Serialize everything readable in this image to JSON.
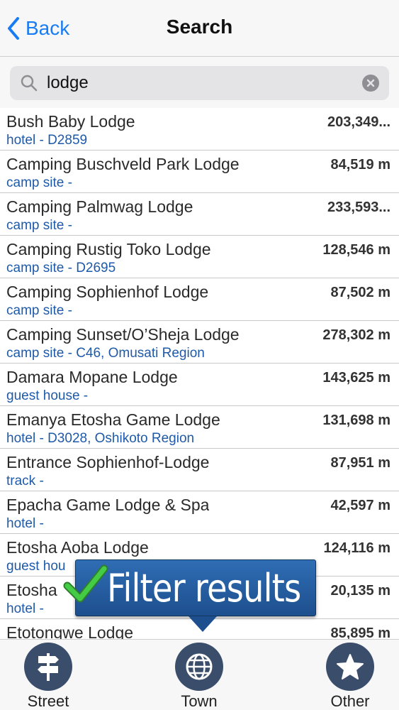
{
  "nav": {
    "back_label": "Back",
    "title": "Search"
  },
  "search": {
    "value": "lodge"
  },
  "results": [
    {
      "name": "Bush Baby Lodge",
      "sub": "hotel - D2859",
      "dist": "203,349..."
    },
    {
      "name": "Camping Buschveld Park Lodge",
      "sub": "camp site -",
      "dist": "84,519 m"
    },
    {
      "name": "Camping Palmwag Lodge",
      "sub": "camp site -",
      "dist": "233,593..."
    },
    {
      "name": "Camping Rustig Toko Lodge",
      "sub": "camp site - D2695",
      "dist": "128,546 m"
    },
    {
      "name": "Camping Sophienhof Lodge",
      "sub": "camp site -",
      "dist": "87,502 m"
    },
    {
      "name": "Camping Sunset/O’Sheja Lodge",
      "sub": "camp site - C46, Omusati Region",
      "dist": "278,302 m"
    },
    {
      "name": "Damara Mopane Lodge",
      "sub": "guest house -",
      "dist": "143,625 m"
    },
    {
      "name": "Emanya Etosha Game Lodge",
      "sub": "hotel - D3028, Oshikoto Region",
      "dist": "131,698 m"
    },
    {
      "name": "Entrance Sophienhof-Lodge",
      "sub": "track -",
      "dist": "87,951 m"
    },
    {
      "name": "Epacha Game Lodge & Spa",
      "sub": "hotel -",
      "dist": "42,597 m"
    },
    {
      "name": "Etosha Aoba Lodge",
      "sub": "guest hou",
      "dist": "124,116 m"
    },
    {
      "name": "Etosha",
      "sub": "hotel -",
      "dist": "20,135 m"
    },
    {
      "name": "Etotongwe Lodge",
      "sub": "",
      "dist": "85,895 m"
    }
  ],
  "tooltip": {
    "text": "Filter results"
  },
  "tabs": [
    {
      "label": "Street",
      "icon": "signpost-icon"
    },
    {
      "label": "Town",
      "icon": "globe-icon"
    },
    {
      "label": "Other",
      "icon": "star-icon"
    }
  ],
  "colors": {
    "accent": "#1a7cf5",
    "subtitle": "#1f5aa8",
    "tab_icon_bg": "#3a4d6a",
    "tooltip_bg": "#2a64a8",
    "check": "#3cc43c"
  }
}
